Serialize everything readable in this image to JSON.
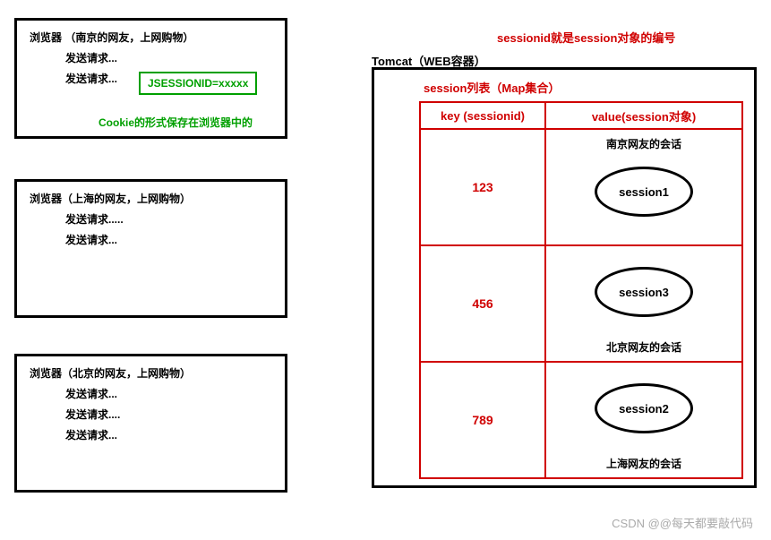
{
  "browsers": [
    {
      "title": "浏览器 （南京的网友，上网购物）",
      "requests": [
        "发送请求...",
        "发送请求..."
      ]
    },
    {
      "title": "浏览器（上海的网友，上网购物）",
      "requests": [
        "发送请求.....",
        "发送请求..."
      ]
    },
    {
      "title": "浏览器（北京的网友，上网购物）",
      "requests": [
        "发送请求...",
        "发送请求....",
        "发送请求..."
      ]
    }
  ],
  "cookie_box": "JSESSIONID=xxxxx",
  "cookie_note": "Cookie的形式保存在浏览器中的",
  "sessionid_note": "sessionid就是session对象的编号",
  "tomcat_title": "Tomcat（WEB容器）",
  "session_list_title": "session列表（Map集合）",
  "table": {
    "headers": {
      "key": "key (sessionid)",
      "value": "value(session对象)"
    },
    "rows": [
      {
        "key": "123",
        "top_label": "南京网友的会话",
        "session": "session1",
        "bottom_label": ""
      },
      {
        "key": "456",
        "top_label": "",
        "session": "session3",
        "bottom_label": "北京网友的会话"
      },
      {
        "key": "789",
        "top_label": "",
        "session": "session2",
        "bottom_label": "上海网友的会话"
      }
    ]
  },
  "watermark": "CSDN @@每天都要敲代码"
}
